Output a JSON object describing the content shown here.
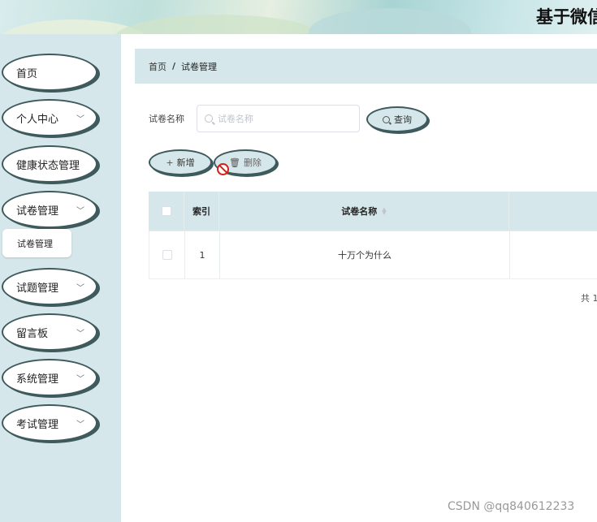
{
  "header": {
    "title": "基于微信"
  },
  "sidebar": {
    "items": [
      {
        "label": "首页",
        "has_chevron": false
      },
      {
        "label": "个人中心",
        "has_chevron": true
      },
      {
        "label": "健康状态管理",
        "has_chevron": false
      },
      {
        "label": "试卷管理",
        "has_chevron": true
      },
      {
        "label": "试题管理",
        "has_chevron": true
      },
      {
        "label": "留言板",
        "has_chevron": true
      },
      {
        "label": "系统管理",
        "has_chevron": true
      },
      {
        "label": "考试管理",
        "has_chevron": true
      }
    ],
    "submenu": {
      "label": "试卷管理"
    }
  },
  "breadcrumb": {
    "home": "首页",
    "separator": "/",
    "current": "试卷管理"
  },
  "search": {
    "label": "试卷名称",
    "placeholder": "试卷名称",
    "button_label": "查询"
  },
  "toolbar": {
    "add_label": "新增",
    "delete_label": "删除"
  },
  "table": {
    "columns": {
      "index": "索引",
      "name": "试卷名称"
    },
    "rows": [
      {
        "index": "1",
        "name": "十万个为什么"
      }
    ]
  },
  "pagination": {
    "total_text": "共 1"
  },
  "watermark": "CSDN @qq840612233",
  "colors": {
    "accent": "#d5e7ea",
    "border": "#3e5a5c"
  }
}
